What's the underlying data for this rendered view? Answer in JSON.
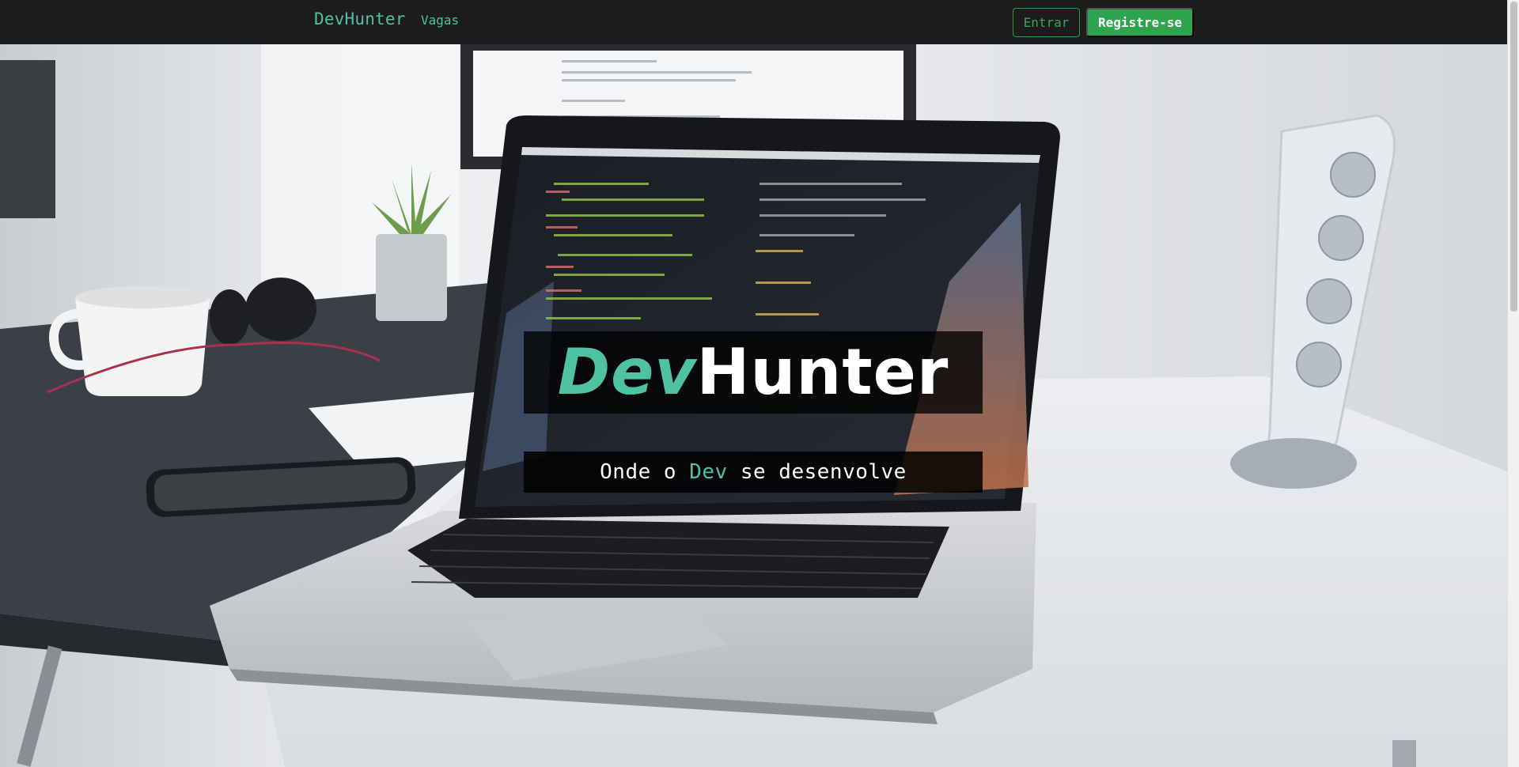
{
  "navbar": {
    "brand": "DevHunter",
    "links": [
      {
        "label": "Vagas"
      }
    ],
    "login_label": "Entrar",
    "register_label": "Registre-se"
  },
  "hero": {
    "title_accent": "Dev",
    "title_rest": "Hunter",
    "subtitle_before": "Onde o ",
    "subtitle_accent": "Dev",
    "subtitle_after": " se desenvolve"
  },
  "colors": {
    "navbar_bg": "#1c1c1c",
    "brand": "#4fc2a4",
    "accent": "#4fc2a4",
    "success": "#2ea44f"
  }
}
